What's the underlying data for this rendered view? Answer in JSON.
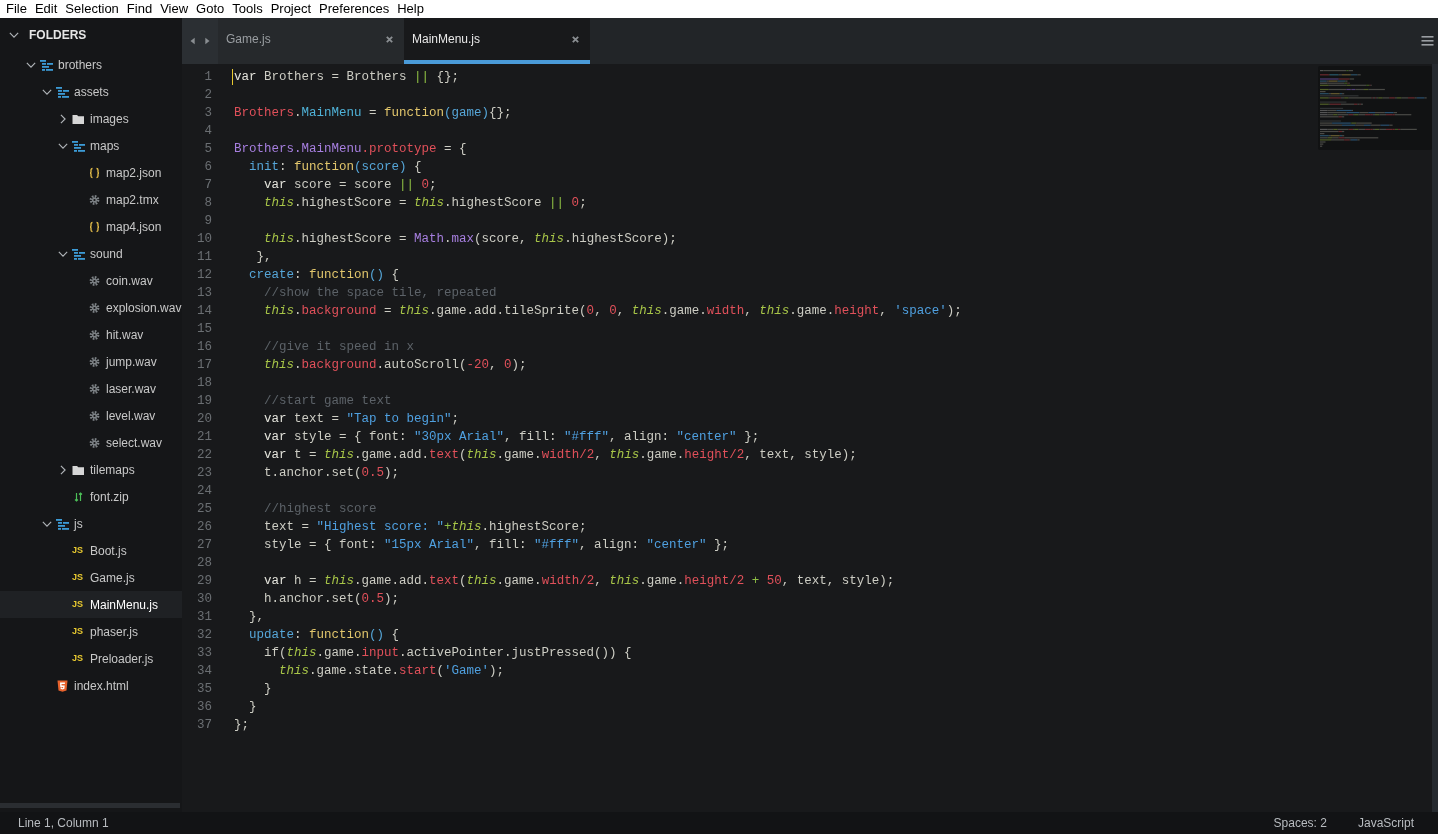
{
  "menu": [
    "File",
    "Edit",
    "Selection",
    "Find",
    "View",
    "Goto",
    "Tools",
    "Project",
    "Preferences",
    "Help"
  ],
  "sidebar": {
    "title": "FOLDERS",
    "expanded": true,
    "items": [
      {
        "label": "brothers",
        "kind": "folder",
        "expanded": true,
        "selected": false,
        "children": [
          {
            "label": "assets",
            "kind": "folder",
            "expanded": true,
            "selected": false,
            "children": [
              {
                "label": "images",
                "kind": "folder",
                "expanded": false,
                "selected": false
              },
              {
                "label": "maps",
                "kind": "folder",
                "expanded": true,
                "selected": false,
                "children": [
                  {
                    "label": "map2.json",
                    "kind": "json",
                    "selected": false
                  },
                  {
                    "label": "map2.tmx",
                    "kind": "gear",
                    "selected": false
                  },
                  {
                    "label": "map4.json",
                    "kind": "json",
                    "selected": false
                  }
                ]
              },
              {
                "label": "sound",
                "kind": "folder",
                "expanded": true,
                "selected": false,
                "children": [
                  {
                    "label": "coin.wav",
                    "kind": "gear",
                    "selected": false
                  },
                  {
                    "label": "explosion.wav",
                    "kind": "gear",
                    "selected": false
                  },
                  {
                    "label": "hit.wav",
                    "kind": "gear",
                    "selected": false
                  },
                  {
                    "label": "jump.wav",
                    "kind": "gear",
                    "selected": false
                  },
                  {
                    "label": "laser.wav",
                    "kind": "gear",
                    "selected": false
                  },
                  {
                    "label": "level.wav",
                    "kind": "gear",
                    "selected": false
                  },
                  {
                    "label": "select.wav",
                    "kind": "gear",
                    "selected": false
                  }
                ]
              },
              {
                "label": "tilemaps",
                "kind": "folder",
                "expanded": false,
                "selected": false
              },
              {
                "label": "font.zip",
                "kind": "zip",
                "selected": false
              }
            ]
          },
          {
            "label": "js",
            "kind": "folder",
            "expanded": true,
            "selected": false,
            "children": [
              {
                "label": "Boot.js",
                "kind": "js",
                "badge": "JS",
                "selected": false
              },
              {
                "label": "Game.js",
                "kind": "js",
                "badge": "JS",
                "selected": false
              },
              {
                "label": "MainMenu.js",
                "kind": "js",
                "badge": "JS",
                "selected": true
              },
              {
                "label": "phaser.js",
                "kind": "js",
                "badge": "JS",
                "selected": false
              },
              {
                "label": "Preloader.js",
                "kind": "js",
                "badge": "JS",
                "selected": false
              }
            ]
          },
          {
            "label": "index.html",
            "kind": "html",
            "selected": false
          }
        ]
      }
    ]
  },
  "tabs": [
    {
      "label": "Game.js",
      "selected": false
    },
    {
      "label": "MainMenu.js",
      "selected": true
    }
  ],
  "code": [
    {
      "number": "1",
      "tokens": [
        {
          "kind": "kw",
          "text": "var"
        },
        {
          "kind": "pl",
          "text": " Brothers = Brothers "
        },
        {
          "kind": "op",
          "text": "||"
        },
        {
          "kind": "pl",
          "text": " {};"
        }
      ]
    },
    {
      "number": "2"
    },
    {
      "number": "3",
      "tokens": [
        {
          "kind": "obj",
          "text": "Brothers"
        },
        {
          "kind": "pl",
          "text": "."
        },
        {
          "kind": "prop",
          "text": "MainMenu"
        },
        {
          "kind": "pl",
          "text": " = "
        },
        {
          "kind": "fn",
          "text": "function"
        },
        {
          "kind": "param",
          "text": "(game)"
        },
        {
          "kind": "pl",
          "text": "{};"
        }
      ]
    },
    {
      "number": "4"
    },
    {
      "number": "5",
      "tokens": [
        {
          "kind": "cls",
          "text": "Brothers.MainMenu"
        },
        {
          "kind": "obj",
          "text": ".prototype"
        },
        {
          "kind": "pl",
          "text": " = {"
        }
      ]
    },
    {
      "number": "6",
      "tokens": [
        {
          "kind": "key",
          "text": "  init"
        },
        {
          "kind": "pl",
          "text": ": "
        },
        {
          "kind": "fn",
          "text": "function"
        },
        {
          "kind": "param",
          "text": "(score)"
        },
        {
          "kind": "pl",
          "text": " {"
        }
      ]
    },
    {
      "number": "7",
      "tokens": [
        {
          "kind": "kw",
          "text": "    var"
        },
        {
          "kind": "pl",
          "text": " score = score "
        },
        {
          "kind": "op",
          "text": "|| "
        },
        {
          "kind": "num",
          "text": "0"
        },
        {
          "kind": "pl",
          "text": ";"
        }
      ]
    },
    {
      "number": "8",
      "tokens": [
        {
          "kind": "this",
          "text": "    this"
        },
        {
          "kind": "pl",
          "text": ".highestScore = "
        },
        {
          "kind": "this",
          "text": "this"
        },
        {
          "kind": "pl",
          "text": ".highestScore "
        },
        {
          "kind": "op",
          "text": "|| "
        },
        {
          "kind": "num",
          "text": "0"
        },
        {
          "kind": "pl",
          "text": ";"
        }
      ]
    },
    {
      "number": "9"
    },
    {
      "number": "10",
      "tokens": [
        {
          "kind": "this",
          "text": "    this"
        },
        {
          "kind": "pl",
          "text": ".highestScore = "
        },
        {
          "kind": "cls",
          "text": "Math"
        },
        {
          "kind": "pl",
          "text": "."
        },
        {
          "kind": "cls",
          "text": "max"
        },
        {
          "kind": "pl",
          "text": "(score, "
        },
        {
          "kind": "this",
          "text": "this"
        },
        {
          "kind": "pl",
          "text": ".highestScore);"
        }
      ]
    },
    {
      "number": "11",
      "tokens": [
        {
          "kind": "pl",
          "text": "   },"
        }
      ]
    },
    {
      "number": "12",
      "tokens": [
        {
          "kind": "key",
          "text": "  create"
        },
        {
          "kind": "pl",
          "text": ": "
        },
        {
          "kind": "fn",
          "text": "function"
        },
        {
          "kind": "param",
          "text": "()"
        },
        {
          "kind": "pl",
          "text": " {"
        }
      ]
    },
    {
      "number": "13",
      "tokens": [
        {
          "kind": "cmt",
          "text": "    //show the space tile, repeated"
        }
      ]
    },
    {
      "number": "14",
      "tokens": [
        {
          "kind": "this",
          "text": "    this"
        },
        {
          "kind": "pl",
          "text": "."
        },
        {
          "kind": "obj",
          "text": "background"
        },
        {
          "kind": "pl",
          "text": " = "
        },
        {
          "kind": "this",
          "text": "this"
        },
        {
          "kind": "pl",
          "text": ".game.add.tileSprite("
        },
        {
          "kind": "num",
          "text": "0"
        },
        {
          "kind": "pl",
          "text": ", "
        },
        {
          "kind": "num",
          "text": "0"
        },
        {
          "kind": "pl",
          "text": ", "
        },
        {
          "kind": "this",
          "text": "this"
        },
        {
          "kind": "pl",
          "text": ".game."
        },
        {
          "kind": "obj",
          "text": "width"
        },
        {
          "kind": "pl",
          "text": ", "
        },
        {
          "kind": "this",
          "text": "this"
        },
        {
          "kind": "pl",
          "text": ".game."
        },
        {
          "kind": "obj",
          "text": "height"
        },
        {
          "kind": "pl",
          "text": ", "
        },
        {
          "kind": "str",
          "text": "'space'"
        },
        {
          "kind": "pl",
          "text": ");"
        }
      ]
    },
    {
      "number": "15"
    },
    {
      "number": "16",
      "tokens": [
        {
          "kind": "cmt",
          "text": "    //give it speed in x"
        }
      ]
    },
    {
      "number": "17",
      "tokens": [
        {
          "kind": "this",
          "text": "    this"
        },
        {
          "kind": "pl",
          "text": "."
        },
        {
          "kind": "obj",
          "text": "background"
        },
        {
          "kind": "pl",
          "text": ".autoScroll("
        },
        {
          "kind": "num",
          "text": "-20"
        },
        {
          "kind": "pl",
          "text": ", "
        },
        {
          "kind": "num",
          "text": "0"
        },
        {
          "kind": "pl",
          "text": ");"
        }
      ]
    },
    {
      "number": "18"
    },
    {
      "number": "19",
      "tokens": [
        {
          "kind": "cmt",
          "text": "    //start game text"
        }
      ]
    },
    {
      "number": "20",
      "tokens": [
        {
          "kind": "kw",
          "text": "    var"
        },
        {
          "kind": "pl",
          "text": " text = "
        },
        {
          "kind": "str",
          "text": "\"Tap to begin\""
        },
        {
          "kind": "pl",
          "text": ";"
        }
      ]
    },
    {
      "number": "21",
      "tokens": [
        {
          "kind": "kw",
          "text": "    var"
        },
        {
          "kind": "pl",
          "text": " style = { font: "
        },
        {
          "kind": "str",
          "text": "\"30px Arial\""
        },
        {
          "kind": "pl",
          "text": ", fill: "
        },
        {
          "kind": "str",
          "text": "\"#fff\""
        },
        {
          "kind": "pl",
          "text": ", align: "
        },
        {
          "kind": "str",
          "text": "\"center\""
        },
        {
          "kind": "pl",
          "text": " };"
        }
      ]
    },
    {
      "number": "22",
      "tokens": [
        {
          "kind": "kw",
          "text": "    var"
        },
        {
          "kind": "pl",
          "text": " t = "
        },
        {
          "kind": "this",
          "text": "this"
        },
        {
          "kind": "pl",
          "text": ".game.add."
        },
        {
          "kind": "obj",
          "text": "text"
        },
        {
          "kind": "pl",
          "text": "("
        },
        {
          "kind": "this",
          "text": "this"
        },
        {
          "kind": "pl",
          "text": ".game."
        },
        {
          "kind": "obj",
          "text": "width"
        },
        {
          "kind": "num",
          "text": "/2"
        },
        {
          "kind": "pl",
          "text": ", "
        },
        {
          "kind": "this",
          "text": "this"
        },
        {
          "kind": "pl",
          "text": ".game."
        },
        {
          "kind": "obj",
          "text": "height"
        },
        {
          "kind": "num",
          "text": "/2"
        },
        {
          "kind": "pl",
          "text": ", text, style);"
        }
      ]
    },
    {
      "number": "23",
      "tokens": [
        {
          "kind": "pl",
          "text": "    t.anchor.set("
        },
        {
          "kind": "num",
          "text": "0.5"
        },
        {
          "kind": "pl",
          "text": ");"
        }
      ]
    },
    {
      "number": "24"
    },
    {
      "number": "25",
      "tokens": [
        {
          "kind": "cmt",
          "text": "    //highest score"
        }
      ]
    },
    {
      "number": "26",
      "tokens": [
        {
          "kind": "pl",
          "text": "    text = "
        },
        {
          "kind": "str",
          "text": "\"Highest score: \""
        },
        {
          "kind": "op",
          "text": "+"
        },
        {
          "kind": "this",
          "text": "this"
        },
        {
          "kind": "pl",
          "text": ".highestScore;"
        }
      ]
    },
    {
      "number": "27",
      "tokens": [
        {
          "kind": "pl",
          "text": "    style = { font: "
        },
        {
          "kind": "str",
          "text": "\"15px Arial\""
        },
        {
          "kind": "pl",
          "text": ", fill: "
        },
        {
          "kind": "str",
          "text": "\"#fff\""
        },
        {
          "kind": "pl",
          "text": ", align: "
        },
        {
          "kind": "str",
          "text": "\"center\""
        },
        {
          "kind": "pl",
          "text": " };"
        }
      ]
    },
    {
      "number": "28"
    },
    {
      "number": "29",
      "tokens": [
        {
          "kind": "kw",
          "text": "    var"
        },
        {
          "kind": "pl",
          "text": " h = "
        },
        {
          "kind": "this",
          "text": "this"
        },
        {
          "kind": "pl",
          "text": ".game.add."
        },
        {
          "kind": "obj",
          "text": "text"
        },
        {
          "kind": "pl",
          "text": "("
        },
        {
          "kind": "this",
          "text": "this"
        },
        {
          "kind": "pl",
          "text": ".game."
        },
        {
          "kind": "obj",
          "text": "width"
        },
        {
          "kind": "num",
          "text": "/2"
        },
        {
          "kind": "pl",
          "text": ", "
        },
        {
          "kind": "this",
          "text": "this"
        },
        {
          "kind": "pl",
          "text": ".game."
        },
        {
          "kind": "obj",
          "text": "height"
        },
        {
          "kind": "num",
          "text": "/2"
        },
        {
          "kind": "op",
          "text": " + "
        },
        {
          "kind": "num",
          "text": "50"
        },
        {
          "kind": "pl",
          "text": ", text, style);"
        }
      ]
    },
    {
      "number": "30",
      "tokens": [
        {
          "kind": "pl",
          "text": "    h.anchor.set("
        },
        {
          "kind": "num",
          "text": "0.5"
        },
        {
          "kind": "pl",
          "text": ");"
        }
      ]
    },
    {
      "number": "31",
      "tokens": [
        {
          "kind": "pl",
          "text": "  },"
        }
      ]
    },
    {
      "number": "32",
      "tokens": [
        {
          "kind": "key",
          "text": "  update"
        },
        {
          "kind": "pl",
          "text": ": "
        },
        {
          "kind": "fn",
          "text": "function"
        },
        {
          "kind": "param",
          "text": "()"
        },
        {
          "kind": "pl",
          "text": " {"
        }
      ]
    },
    {
      "number": "33",
      "tokens": [
        {
          "kind": "pl",
          "text": "    if("
        },
        {
          "kind": "this",
          "text": "this"
        },
        {
          "kind": "pl",
          "text": ".game."
        },
        {
          "kind": "obj",
          "text": "input"
        },
        {
          "kind": "pl",
          "text": ".activePointer.justPressed()) {"
        }
      ]
    },
    {
      "number": "34",
      "tokens": [
        {
          "kind": "this",
          "text": "      this"
        },
        {
          "kind": "pl",
          "text": ".game.state."
        },
        {
          "kind": "obj",
          "text": "start"
        },
        {
          "kind": "pl",
          "text": "("
        },
        {
          "kind": "str",
          "text": "'Game'"
        },
        {
          "kind": "pl",
          "text": ");"
        }
      ]
    },
    {
      "number": "35",
      "tokens": [
        {
          "kind": "pl",
          "text": "    }"
        }
      ]
    },
    {
      "number": "36",
      "tokens": [
        {
          "kind": "pl",
          "text": "  }"
        }
      ]
    },
    {
      "number": "37",
      "tokens": [
        {
          "kind": "pl",
          "text": "};"
        }
      ]
    }
  ],
  "status_bar": {
    "position": "Line 1, Column 1",
    "indentation": "Spaces: 2",
    "syntax": "JavaScript"
  }
}
